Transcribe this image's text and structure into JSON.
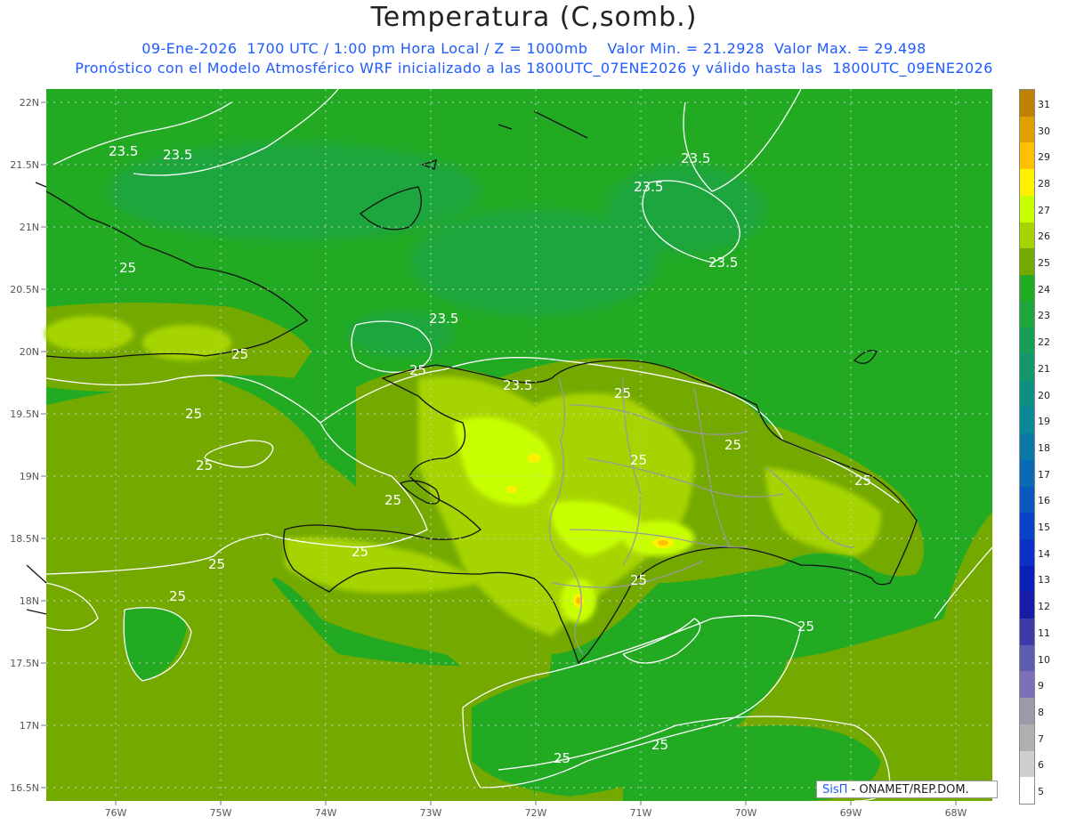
{
  "title": "Temperatura (C,somb.)",
  "subtitle_line1": "09-Ene-2026  1700 UTC / 1:00 pm Hora Local / Z = 1000mb    Valor Min. = 21.2928  Valor Max. = 29.498",
  "subtitle_line2": "Pronóstico con el Modelo Atmosférico WRF inicializado a las 1800UTC_07ENE2026 y válido hasta las  1800UTC_09ENE2026",
  "lat_ticks": [
    "22N",
    "21.5N",
    "21N",
    "20.5N",
    "20N",
    "19.5N",
    "19N",
    "18.5N",
    "18N",
    "17.5N",
    "17N",
    "16.5N"
  ],
  "lon_ticks": [
    "76W",
    "75W",
    "74W",
    "73W",
    "72W",
    "71W",
    "70W",
    "69W",
    "68W"
  ],
  "contour_labels": [
    "23.5",
    "23.5",
    "23.5",
    "23.5",
    "23.5",
    "23.5",
    "23.5",
    "25",
    "25",
    "25",
    "25",
    "25",
    "25",
    "25",
    "25",
    "25",
    "25",
    "25",
    "25",
    "25",
    "25",
    "25",
    "25",
    "25"
  ],
  "credit": {
    "brand": "SisΠ",
    "text": " - ONAMET/REP.DOM."
  },
  "colorbar": {
    "labels": [
      "31",
      "30",
      "29",
      "28",
      "27",
      "26",
      "25",
      "24",
      "23",
      "22",
      "21",
      "20",
      "19",
      "18",
      "17",
      "16",
      "15",
      "14",
      "13",
      "12",
      "11",
      "10",
      "9",
      "8",
      "7",
      "6",
      "5"
    ],
    "colors": [
      "#c08000",
      "#e0a000",
      "#ffc000",
      "#fff000",
      "#c8ff00",
      "#a6d400",
      "#74aa00",
      "#22aa22",
      "#1ca63c",
      "#179d55",
      "#13966d",
      "#0f8f84",
      "#0b8797",
      "#0a79a6",
      "#0a6ab6",
      "#0a57c0",
      "#0a43c8",
      "#0a30c8",
      "#0a1eb8",
      "#1a1aa8",
      "#3c3ca8",
      "#5c5cb0",
      "#7e70b8",
      "#9a9aa8",
      "#b0b0b0",
      "#cfcfcf",
      "#ffffff"
    ]
  }
}
